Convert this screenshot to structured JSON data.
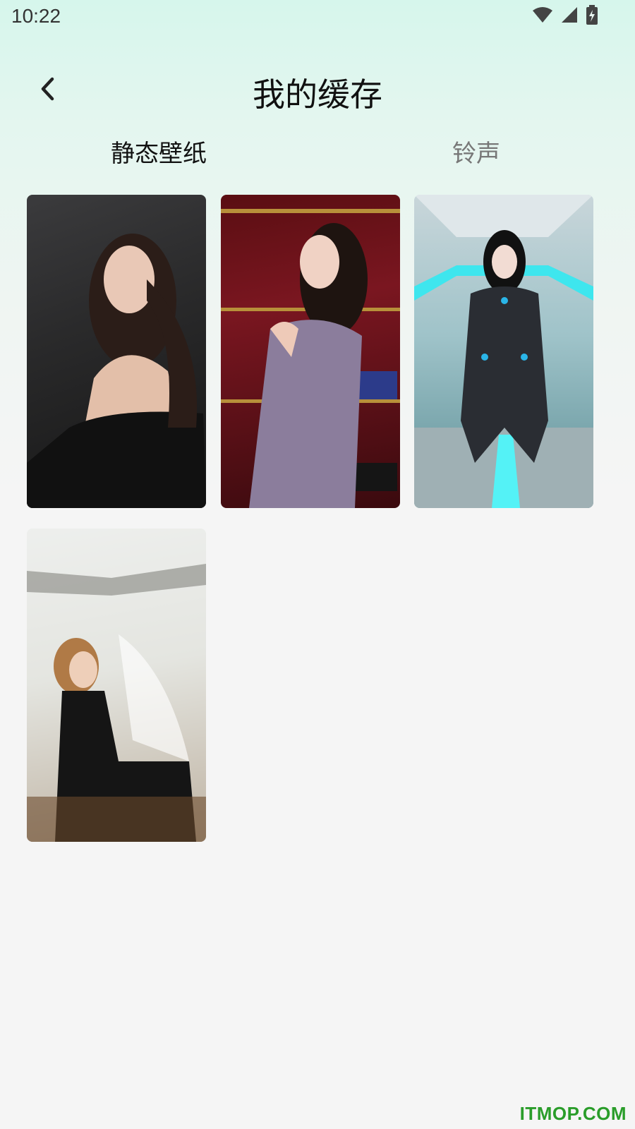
{
  "status_bar": {
    "time": "10:22",
    "icons": [
      "wifi-icon",
      "signal-icon",
      "battery-charging-icon"
    ]
  },
  "header": {
    "title": "我的缓存",
    "back_icon": "chevron-left-icon"
  },
  "tabs": [
    {
      "label": "静态壁纸",
      "active": true
    },
    {
      "label": "铃声",
      "active": false
    }
  ],
  "wallpapers": [
    {
      "subject": "woman in black top against dark grey background"
    },
    {
      "subject": "woman in purple dress in front of red curtains and shoe shelf"
    },
    {
      "subject": "cosplayer in black bodysuit with cyan neon lights"
    },
    {
      "subject": "woman in black dress by sheer window curtains"
    }
  ],
  "watermark": "ITMOP.COM",
  "colors": {
    "active_tab": "#111111",
    "inactive_tab": "#777777",
    "watermark": "#2a9d2a"
  }
}
